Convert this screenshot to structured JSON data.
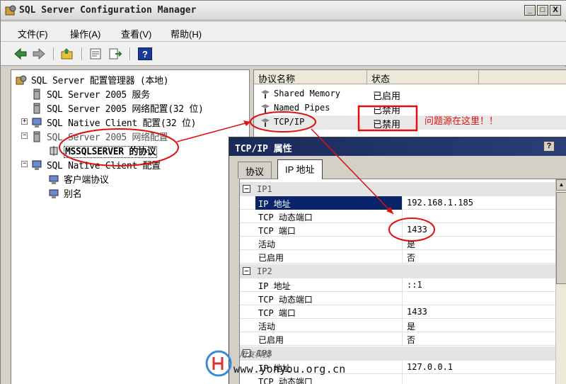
{
  "window": {
    "title": "SQL Server Configuration Manager",
    "min": "_",
    "max": "□",
    "close": "X"
  },
  "menu": {
    "file": "文件(F)",
    "action": "操作(A)",
    "view": "查看(V)",
    "help": "帮助(H)"
  },
  "toolbar": {
    "icons": [
      "back-arrow-icon",
      "forward-arrow-icon",
      "up-folder-icon",
      "properties-icon",
      "export-icon",
      "help-icon"
    ],
    "help_glyph": "?"
  },
  "tree": {
    "root": "SQL Server 配置管理器 (本地)",
    "items": [
      "SQL Server 2005 服务",
      "SQL Server 2005 网络配置(32 位)",
      "SQL Native Client 配置(32 位)",
      "SQL Server 2005 网络配置",
      "MSSQLSERVER 的协议",
      "SQL Native Client 配置",
      "客户端协议",
      "别名"
    ],
    "expand_plus": "+",
    "expand_minus": "−"
  },
  "list": {
    "col_name": "协议名称",
    "col_status": "状态",
    "rows": [
      {
        "name": "Shared Memory",
        "status": "已启用"
      },
      {
        "name": "Named Pipes",
        "status": "已禁用"
      },
      {
        "name": "TCP/IP",
        "status": "已禁用"
      }
    ]
  },
  "annotation": {
    "text": "问题源在这里！！",
    "color": "#e01010"
  },
  "dialog": {
    "title": "TCP/IP 属性",
    "help_glyph": "?",
    "tab_protocol": "协议",
    "tab_ip": "IP 地址",
    "sections": [
      {
        "name": "IP1",
        "rows": [
          {
            "key": "IP 地址",
            "value": "192.168.1.185"
          },
          {
            "key": "TCP 动态端口",
            "value": ""
          },
          {
            "key": "TCP 端口",
            "value": "1433"
          },
          {
            "key": "活动",
            "value": "是"
          },
          {
            "key": "已启用",
            "value": "否"
          }
        ]
      },
      {
        "name": "IP2",
        "rows": [
          {
            "key": "IP 地址",
            "value": "::1"
          },
          {
            "key": "TCP 动态端口",
            "value": ""
          },
          {
            "key": "TCP 端口",
            "value": "1433"
          },
          {
            "key": "活动",
            "value": "是"
          },
          {
            "key": "已启用",
            "value": "否"
          }
        ]
      },
      {
        "name": "IP3",
        "rows": [
          {
            "key": "IP 地址",
            "value": "127.0.0.1"
          },
          {
            "key": "TCP 动态端口",
            "value": ""
          }
        ]
      }
    ],
    "collapse_glyph": "−",
    "scroll_up_glyph": "▲"
  },
  "watermark": {
    "brand": "用友科技",
    "url": "www.yonyou.org.cn"
  },
  "colors": {
    "selection": "#0a246a",
    "annotation_red": "#e01010",
    "dialog_title": "#1a2a58"
  }
}
